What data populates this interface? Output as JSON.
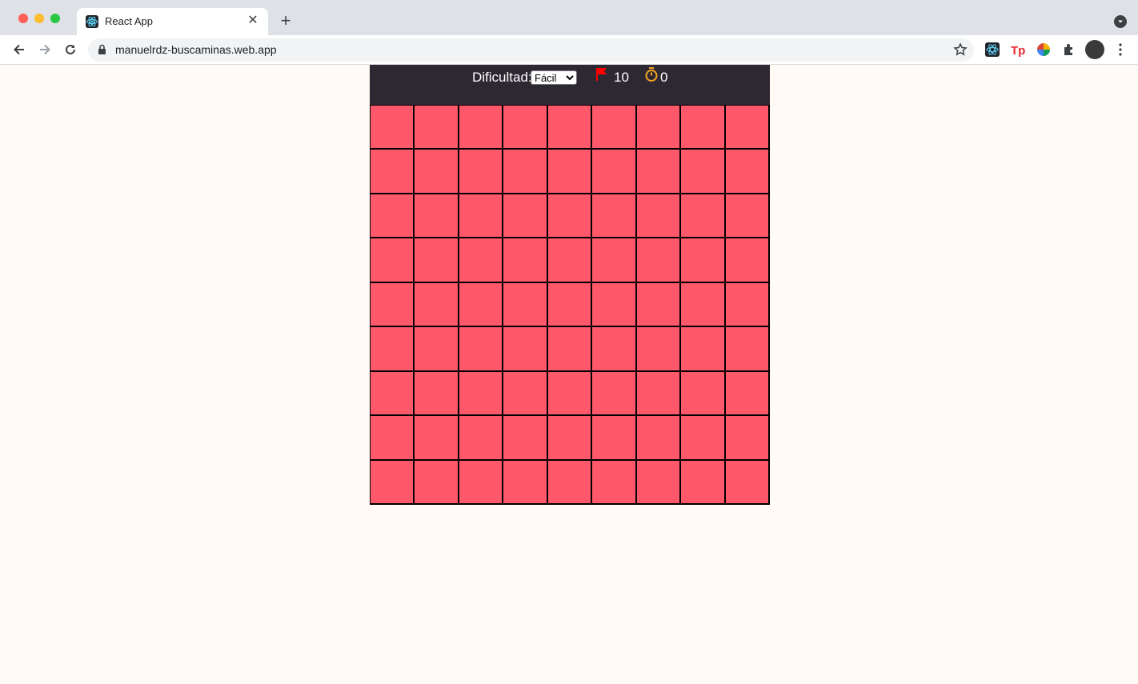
{
  "browser": {
    "tab_title": "React App",
    "url": "manuelrdz-buscaminas.web.app",
    "tab_close": "✕",
    "new_tab": "+"
  },
  "game": {
    "difficulty_label": "Dificultad:",
    "difficulty_selected": "Fácil",
    "flags": "10",
    "timer": "0",
    "rows": 9,
    "cols": 9,
    "cell_color": "#ff586b",
    "header_color": "#2e2832"
  }
}
